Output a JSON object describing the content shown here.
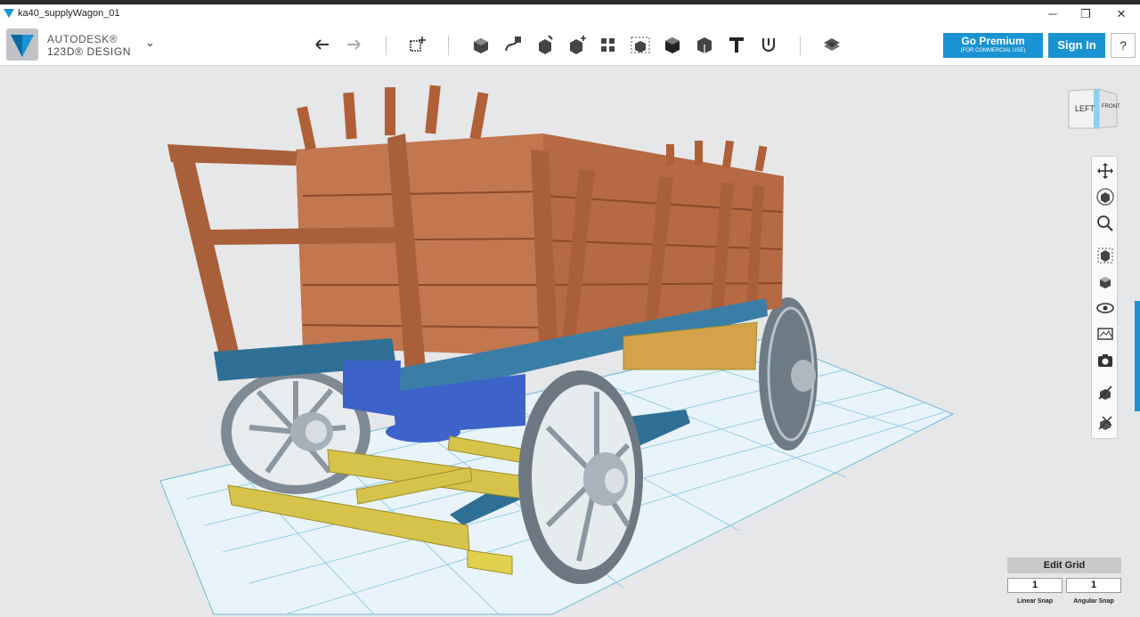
{
  "window": {
    "title": "ka40_supplyWagon_01",
    "minimize": "─",
    "maximize": "❐",
    "close": "✕"
  },
  "brand": {
    "line1": "AUTODESK®",
    "line2": "123D® DESIGN",
    "menu_caret": "⌄"
  },
  "toolbar": {
    "tools": [
      "undo-icon",
      "redo-icon",
      "primitives-icon",
      "sketch-icon",
      "construct-icon",
      "modify-icon",
      "pattern-icon",
      "grouping-icon",
      "combine-icon",
      "measure-icon",
      "snap-icon",
      "text-icon",
      "material-icon",
      "layers-icon"
    ]
  },
  "actions": {
    "premium_label": "Go Premium",
    "premium_sub": "(FOR COMMERCIAL USE)",
    "signin_label": "Sign In",
    "help_label": "?"
  },
  "viewcube": {
    "left_label": "LEFT",
    "front_label": "FRONT"
  },
  "navigation": [
    "pan-icon",
    "orbit-icon",
    "zoom-icon",
    "fit-icon",
    "view-icon",
    "visibility-icon",
    "materials-icon",
    "screenshot-icon",
    "snap-tool-icon",
    "extra-tool-icon"
  ],
  "grid": {
    "edit_label": "Edit Grid",
    "linear_value": "1",
    "linear_label": "Linear Snap",
    "angular_value": "1",
    "angular_label": "Angular Snap"
  },
  "colors": {
    "accent": "#1a93d2",
    "wood": "#b86b43",
    "frame_blue": "#2f6f95",
    "axle_yellow": "#d8c54a",
    "wheel_gray": "#9aa4ad",
    "grid_line": "#7ec4e0"
  }
}
